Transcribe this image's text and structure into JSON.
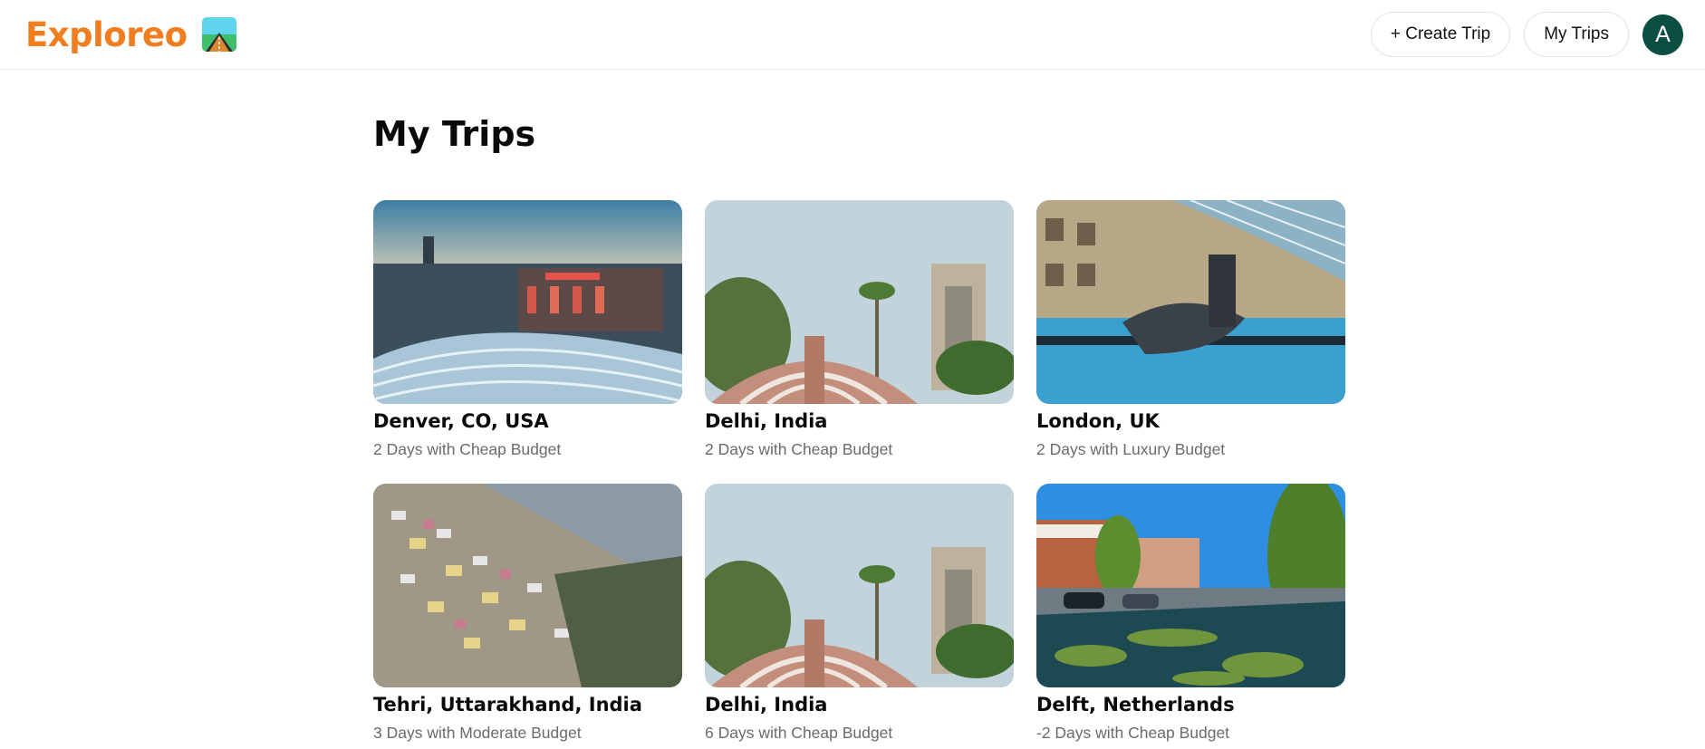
{
  "header": {
    "brand": "Exploreo",
    "create_trip_label": "+ Create Trip",
    "my_trips_label": "My Trips",
    "avatar_initial": "A"
  },
  "main": {
    "title": "My Trips",
    "trips": [
      {
        "name": "Denver, CO, USA",
        "summary": "2 Days with Cheap Budget",
        "image": "denver-union-station-photo"
      },
      {
        "name": "Delhi, India",
        "summary": "2 Days with Cheap Budget",
        "image": "delhi-jantar-mantar-photo"
      },
      {
        "name": "London, UK",
        "summary": "2 Days with Luxury Budget",
        "image": "london-hays-galleria-photo"
      },
      {
        "name": "Tehri, Uttarakhand, India",
        "summary": "3 Days with Moderate Budget",
        "image": "tehri-hillside-town-photo"
      },
      {
        "name": "Delhi, India",
        "summary": "6 Days with Cheap Budget",
        "image": "delhi-jantar-mantar-photo"
      },
      {
        "name": "Delft, Netherlands",
        "summary": "-2 Days with Cheap Budget",
        "image": "delft-canal-photo"
      }
    ]
  },
  "colors": {
    "brand": "#f07d1f",
    "avatar_bg": "#0b4f42",
    "subtitle": "#6b6b6b",
    "border": "#e2e2e2"
  }
}
